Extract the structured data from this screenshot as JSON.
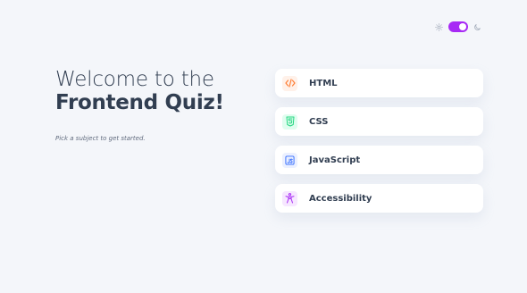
{
  "colors": {
    "background": "#f4f6fa",
    "text_dark": "#313e51",
    "text_muted": "#626c7f",
    "accent": "#a729f5",
    "html_icon_bg": "#fff1e9",
    "html_icon": "#ff7e35",
    "css_icon_bg": "#e0fdef",
    "css_icon": "#26d782",
    "js_icon_bg": "#ebf0ff",
    "js_icon": "#306aff",
    "a11y_icon_bg": "#f6e7ff",
    "a11y_icon": "#a729f5"
  },
  "theme_toggle": {
    "left_icon": "sun-icon",
    "right_icon": "moon-icon",
    "dark_mode": true
  },
  "welcome": {
    "line1": "Welcome to the",
    "line2": "Frontend Quiz!",
    "subtitle": "Pick a subject to get started."
  },
  "subjects": [
    {
      "label": "HTML",
      "icon": "code-icon"
    },
    {
      "label": "CSS",
      "icon": "css-shield-icon"
    },
    {
      "label": "JavaScript",
      "icon": "javascript-icon"
    },
    {
      "label": "Accessibility",
      "icon": "accessibility-icon"
    }
  ]
}
